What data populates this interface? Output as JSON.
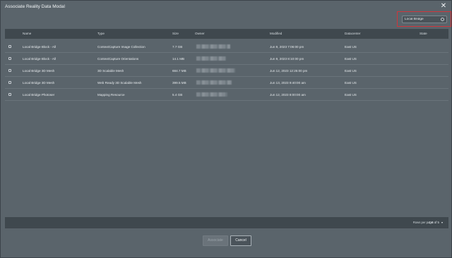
{
  "modal": {
    "title": "Associate Reality Data Modal",
    "close_icon": "close-icon"
  },
  "search": {
    "value": "Local Bridge",
    "icon": "search-icon"
  },
  "table": {
    "columns": [
      "Name",
      "Type",
      "Size",
      "Owner",
      "Modified",
      "Datacenter",
      "State"
    ],
    "rows": [
      {
        "name": "Local Bridge Block - All",
        "type": "ContextCapture Image Collection",
        "size": "7.7 GB",
        "modified": "Jun 9, 2023 7:06:00 pm",
        "datacenter": "East US",
        "state": ""
      },
      {
        "name": "Local Bridge Block - All",
        "type": "ContextCapture Orientations",
        "size": "14.1 MB",
        "modified": "Jun 9, 2023 8:10:00 pm",
        "datacenter": "East US",
        "state": ""
      },
      {
        "name": "Local Bridge 3D Mesh",
        "type": "3D Scalable Mesh",
        "size": "684.7 MB",
        "modified": "Jun 12, 2023 12:25:00 pm",
        "datacenter": "East US",
        "state": ""
      },
      {
        "name": "Local Bridge 3D Mesh",
        "type": "Web Ready 3D Scalable Mesh",
        "size": "399.5 MB",
        "modified": "Jun 13, 2023 9:40:00 am",
        "datacenter": "East US",
        "state": ""
      },
      {
        "name": "Local Bridge Photoser",
        "type": "Mapping Resource",
        "size": "5.4 GB",
        "modified": "Jun 12, 2023 8:00:00 am",
        "datacenter": "East US",
        "state": ""
      }
    ]
  },
  "pagination": {
    "rows_per_page_label": "Rows per page",
    "range": "1-5 of 5",
    "chevron_icon": "chevron-down-icon"
  },
  "actions": {
    "associate_label": "Associate",
    "cancel_label": "Cancel"
  }
}
